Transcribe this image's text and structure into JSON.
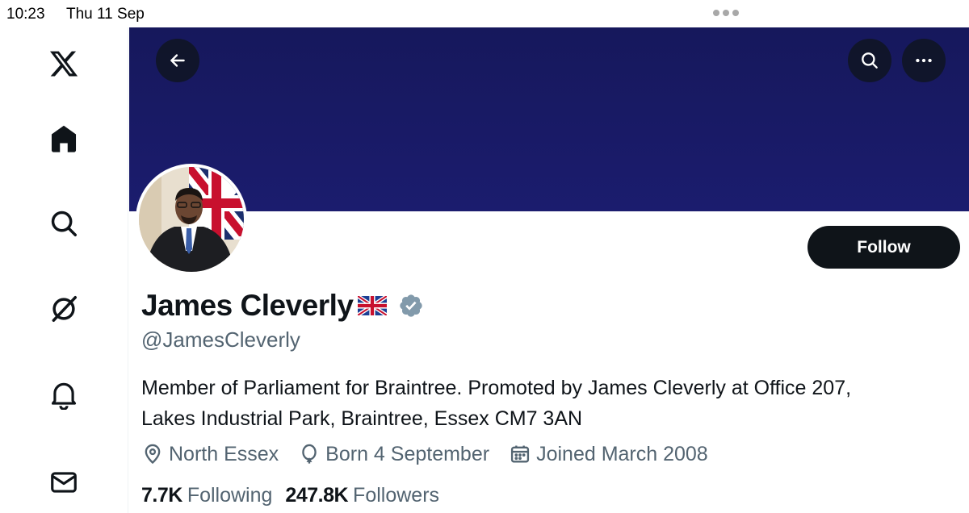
{
  "status_bar": {
    "time": "10:23",
    "date": "Thu 11 Sep"
  },
  "sidebar": {
    "items": [
      {
        "name": "x-logo-icon"
      },
      {
        "name": "home-icon"
      },
      {
        "name": "search-icon"
      },
      {
        "name": "grok-icon"
      },
      {
        "name": "bell-icon"
      },
      {
        "name": "mail-icon"
      }
    ]
  },
  "header": {
    "banner_color": "#1a1b68",
    "back_icon": "arrow-left-icon",
    "search_icon": "search-icon",
    "more_icon": "more-dots-icon"
  },
  "profile": {
    "display_name": "James Cleverly",
    "flag": "uk-flag-emoji",
    "verified": true,
    "handle": "@JamesCleverly",
    "follow_label": "Follow",
    "bio_line1": "Member of Parliament for Braintree. Promoted by James Cleverly at Office 207,",
    "bio_line2": "Lakes Industrial Park, Braintree, Essex CM7 3AN",
    "location": "North Essex",
    "birthday": "Born 4 September",
    "joined": "Joined March 2008",
    "following_count": "7.7K",
    "following_label": "Following",
    "followers_count": "247.8K",
    "followers_label": "Followers"
  },
  "colors": {
    "text_primary": "#0f1419",
    "text_secondary": "#536471",
    "verified": "#829aab"
  }
}
